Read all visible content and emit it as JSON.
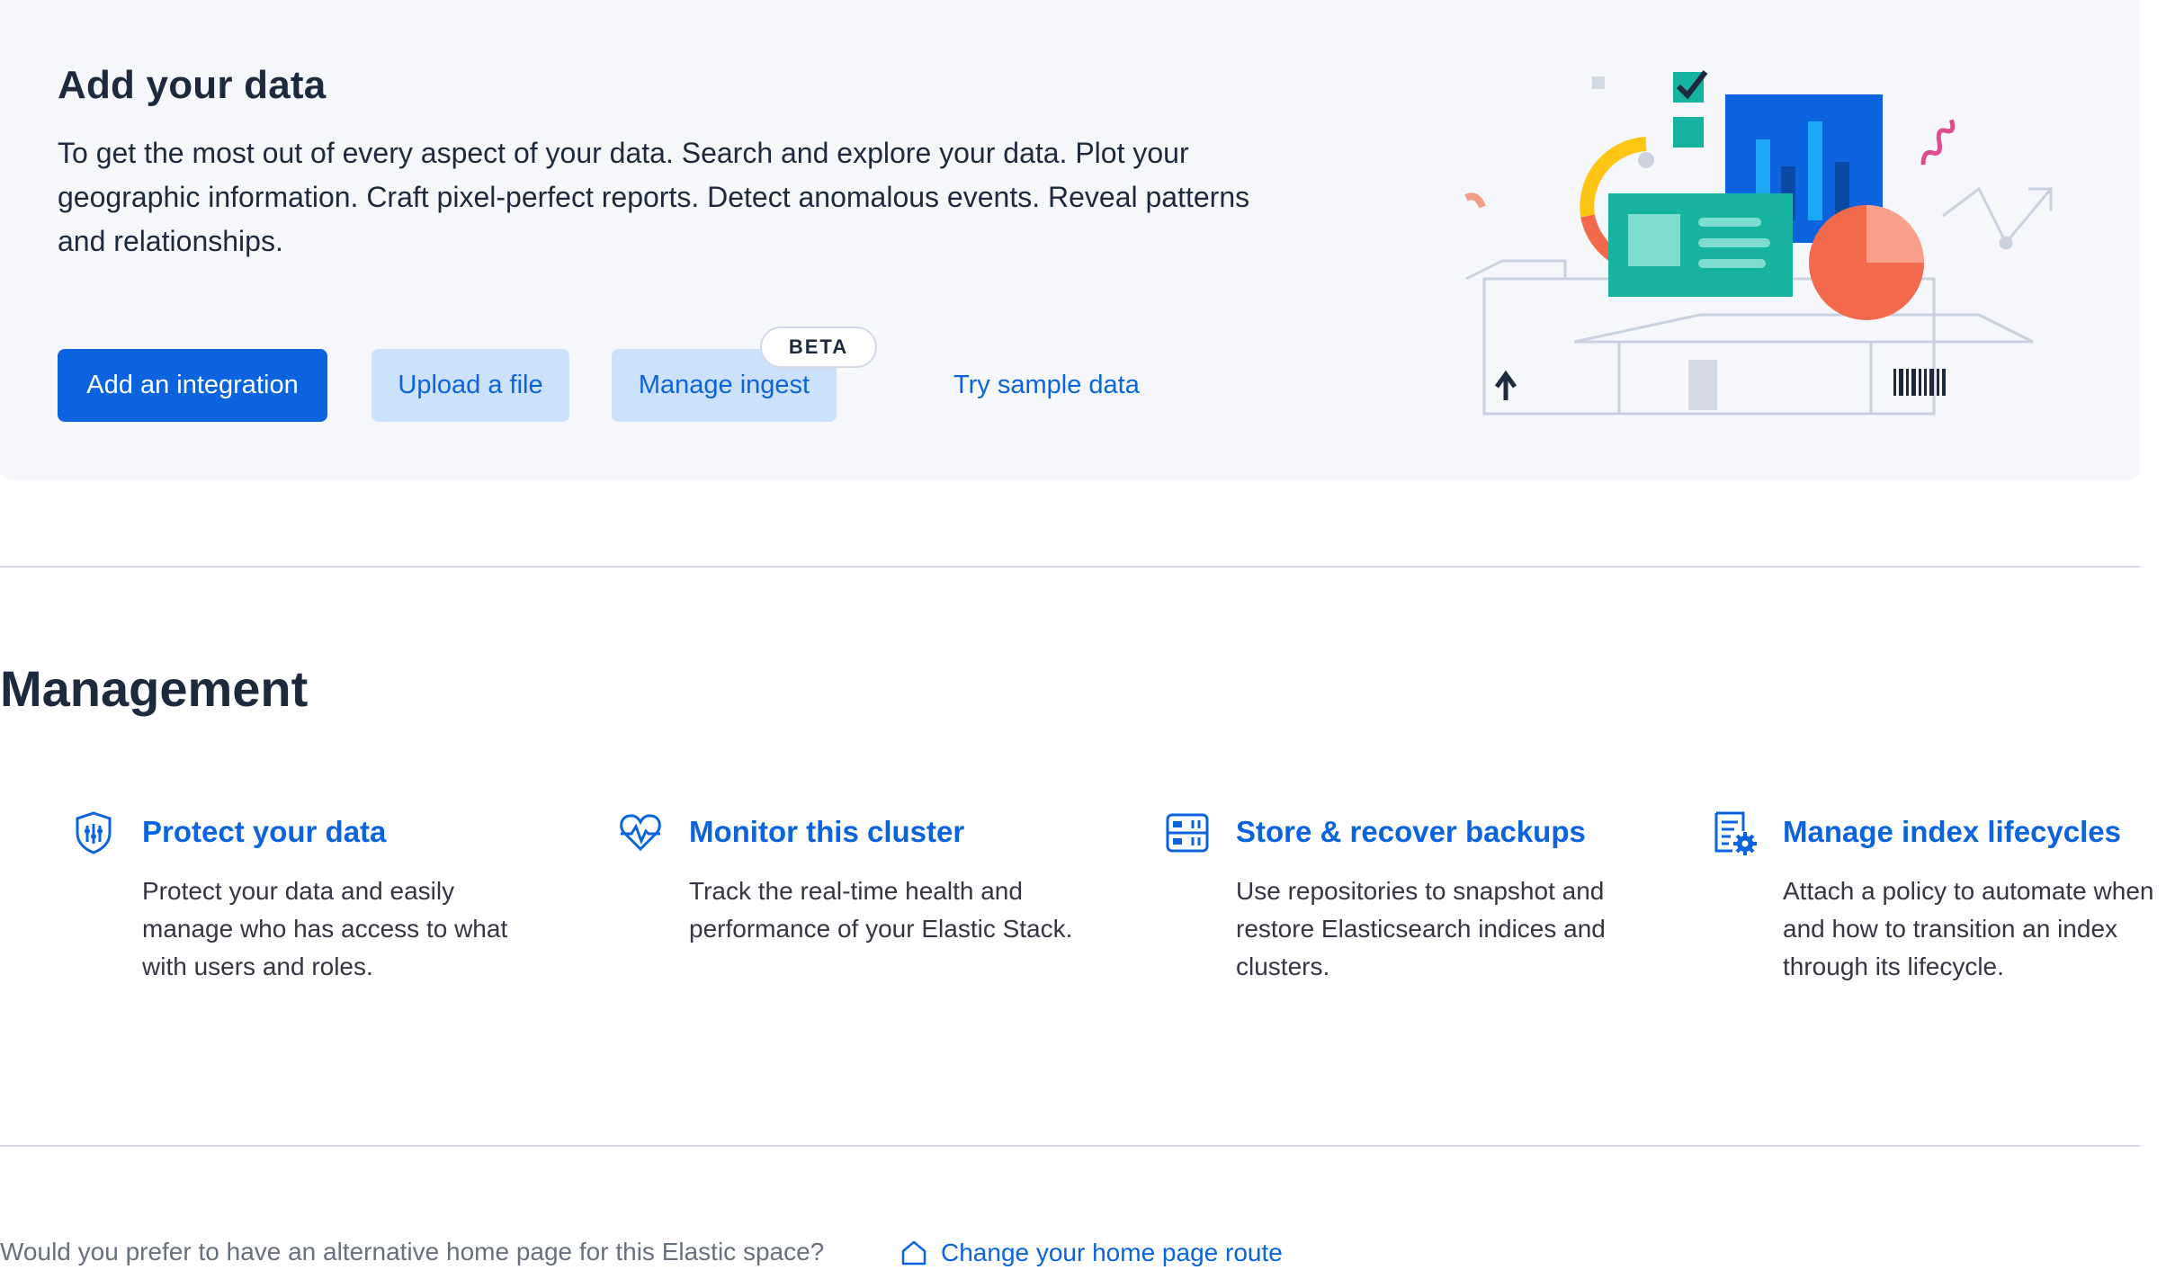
{
  "add_data": {
    "title": "Add your data",
    "description": "To get the most out of every aspect of your data. Search and explore your data. Plot your geographic information. Craft pixel-perfect reports. Detect anomalous events. Reveal patterns and relationships.",
    "buttons": {
      "add_integration": "Add an integration",
      "upload_file": "Upload a file",
      "manage_ingest": "Manage ingest",
      "manage_ingest_badge": "BETA",
      "try_sample_data": "Try sample data"
    },
    "illustration": "add-data-illustration"
  },
  "management": {
    "title": "Management",
    "cards": [
      {
        "icon": "security-shield-icon",
        "title": "Protect your data",
        "description": "Protect your data and easily manage who has access to what with users and roles."
      },
      {
        "icon": "monitoring-heart-icon",
        "title": "Monitor this cluster",
        "description": "Track the real-time health and performance of your Elastic Stack."
      },
      {
        "icon": "backup-storage-icon",
        "title": "Store & recover backups",
        "description": "Use repositories to snapshot and restore Elasticsearch indices and clusters."
      },
      {
        "icon": "index-lifecycle-icon",
        "title": "Manage index lifecycles",
        "description": "Attach a policy to automate when and how to transition an index through its lifecycle."
      }
    ]
  },
  "footer": {
    "question": "Would you prefer to have an alternative home page for this Elastic space?",
    "link_label": "Change your home page route",
    "link_icon": "home-icon"
  },
  "colors": {
    "primary": "#0b64dd",
    "secondary_bg": "#cce1fa",
    "panel_bg": "#f5f7fa",
    "text": "#1d2a3e",
    "muted_text": "#69707d",
    "divider": "#d3dae6"
  }
}
